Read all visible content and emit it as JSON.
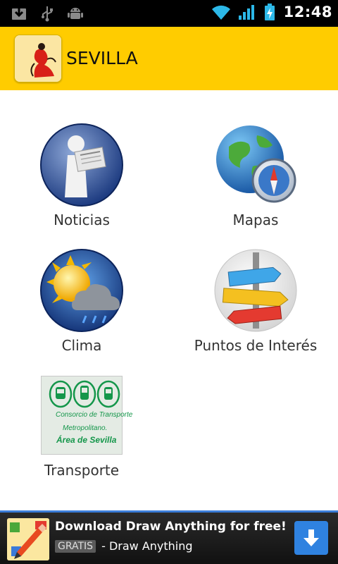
{
  "status_bar": {
    "time": "12:48",
    "icons": [
      "download-notification-icon",
      "usb-icon",
      "android-debug-icon",
      "wifi-icon",
      "signal-icon",
      "battery-charging-icon"
    ]
  },
  "header": {
    "logo_text": "SEVILLA",
    "title": "SEVILLA"
  },
  "menu": {
    "items": [
      {
        "label": "Noticias",
        "icon": "news-icon"
      },
      {
        "label": "Mapas",
        "icon": "globe-compass-icon"
      },
      {
        "label": "Clima",
        "icon": "weather-icon"
      },
      {
        "label": "Puntos de Interés",
        "icon": "signpost-icon"
      },
      {
        "label": "Transporte",
        "icon": "transport-icon"
      }
    ],
    "transport_icon_text": {
      "line1": "Consorcio de Transporte",
      "line2": "Metropolitano.",
      "line3": "Área de Sevilla"
    }
  },
  "ad": {
    "title": "Download Draw Anything for free!",
    "badge": "GRATIS",
    "text": "- Draw Anything",
    "colors": {
      "border": "#3b7dd8",
      "button": "#2f82e0"
    }
  },
  "colors": {
    "header_bg": "#ffcc00",
    "status_bg": "#000000"
  }
}
